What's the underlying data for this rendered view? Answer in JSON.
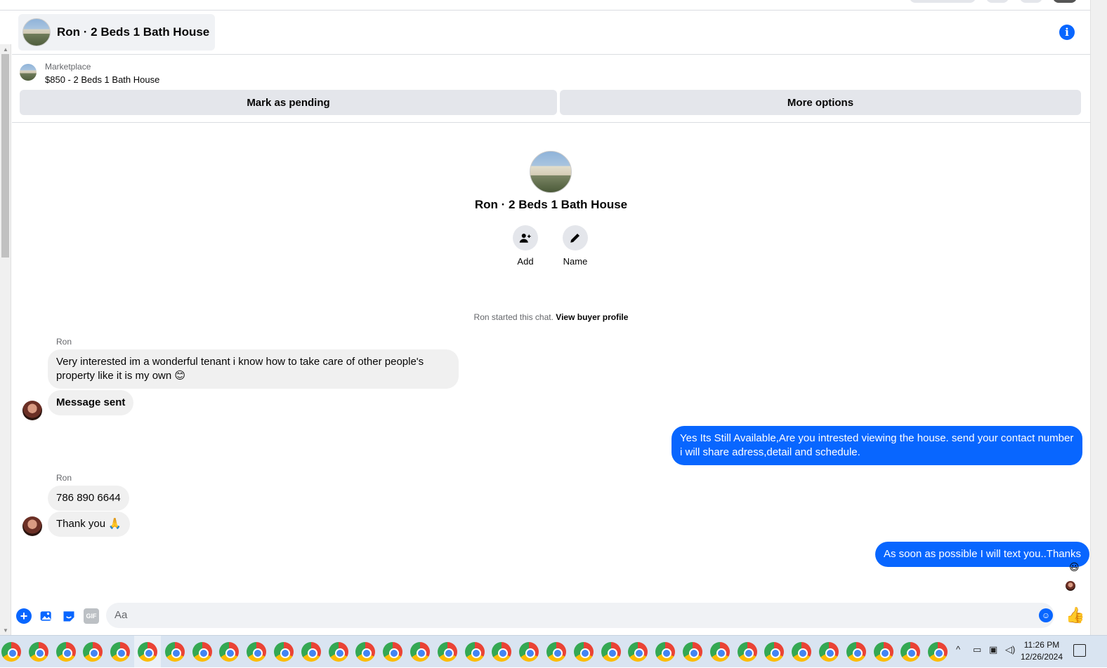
{
  "header": {
    "title": "Ron · 2 Beds 1 Bath House",
    "info_icon": "info-icon"
  },
  "listing": {
    "source": "Marketplace",
    "price_title": "$850 - 2 Beds 1 Bath House",
    "mark_pending_label": "Mark as pending",
    "more_options_label": "More options"
  },
  "intro": {
    "name": "Ron · 2 Beds 1 Bath House",
    "add_label": "Add",
    "name_label": "Name",
    "started_text": "Ron started this chat.",
    "view_profile_label": "View buyer profile"
  },
  "messages": {
    "group1_sender": "Ron",
    "m1": "Very interested im a wonderful tenant i know how to take care of other people's property like it is my own",
    "m1_emoji": "😊",
    "m2": "Message sent",
    "m3": "Yes Its Still Available,Are you intrested viewing the house. send your contact number i will share adress,detail and schedule.",
    "group2_sender": "Ron",
    "m4": "786 890 6644",
    "m5": "Thank you",
    "m5_emoji": "🙏",
    "m6": "As soon as possible I will text you..Thanks",
    "m6_reaction": "😃"
  },
  "composer": {
    "placeholder": "Aa",
    "gif_label": "GIF"
  },
  "taskbar": {
    "time": "11:26 PM",
    "date": "12/26/2024"
  },
  "colors": {
    "accent": "#0866ff",
    "incoming_bubble": "#f0f0f0",
    "button_bg": "#e4e6eb"
  }
}
